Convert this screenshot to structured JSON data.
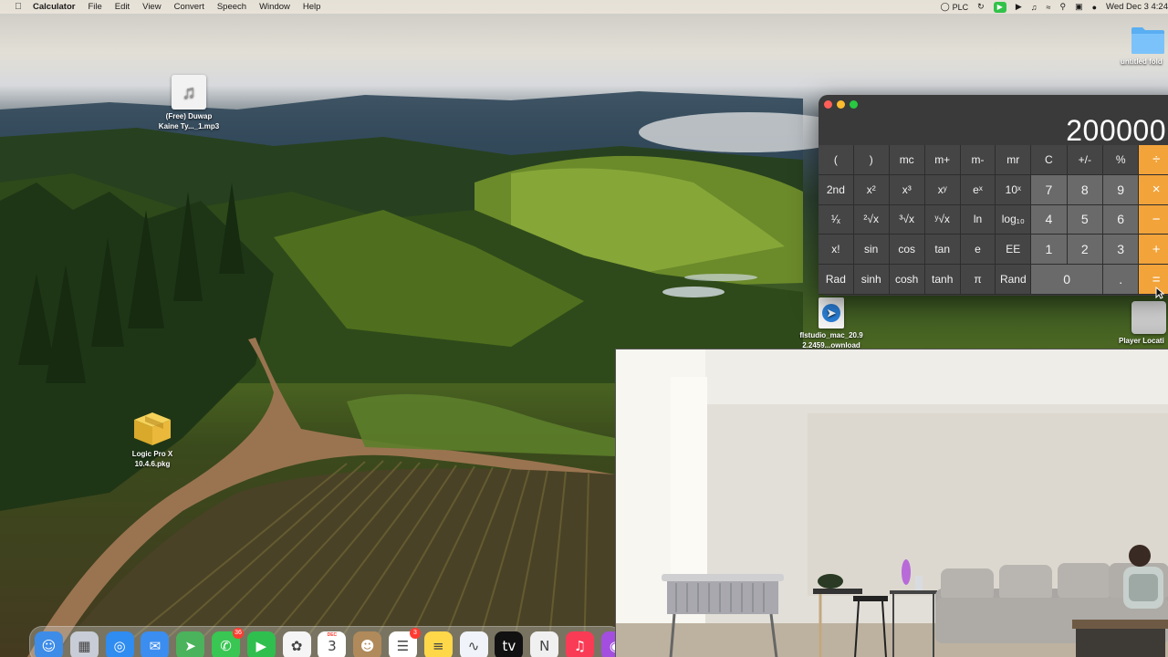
{
  "menubar": {
    "apple_icon": "apple-icon",
    "app_name": "Calculator",
    "menus": [
      "File",
      "Edit",
      "View",
      "Convert",
      "Speech",
      "Window",
      "Help"
    ],
    "status": {
      "plc_label": "PLC",
      "clock": "Wed Dec 3  4:24"
    }
  },
  "desktop": {
    "icons": [
      {
        "label_line1": "(Free) Duwap",
        "label_line2": "Kaine Ty..._1.mp3",
        "type": "music-file-icon"
      },
      {
        "label_line1": "Logic Pro X",
        "label_line2": "10.4.6.pkg",
        "type": "package-icon"
      },
      {
        "label_line1": "untitled fold",
        "label_line2": "",
        "type": "folder-icon"
      },
      {
        "label_line1": "flstudio_mac_20.9",
        "label_line2": "2.2459...ownload",
        "type": "app-file-icon"
      },
      {
        "label_line1": "Player Locati",
        "label_line2": "",
        "type": "disk-icon"
      }
    ]
  },
  "calculator": {
    "display": "200000",
    "rows": [
      [
        "(",
        ")",
        "mc",
        "m+",
        "m-",
        "mr",
        "C",
        "+/-",
        "%",
        "÷"
      ],
      [
        "2nd",
        "x²",
        "x³",
        "xʸ",
        "eˣ",
        "10ˣ",
        "7",
        "8",
        "9",
        "×"
      ],
      [
        "¹⁄ₓ",
        "²√x",
        "³√x",
        "ʸ√x",
        "ln",
        "log₁₀",
        "4",
        "5",
        "6",
        "−"
      ],
      [
        "x!",
        "sin",
        "cos",
        "tan",
        "e",
        "EE",
        "1",
        "2",
        "3",
        "+"
      ],
      [
        "Rad",
        "sinh",
        "cosh",
        "tanh",
        "π",
        "Rand",
        "0",
        ".",
        "="
      ]
    ],
    "accent_color": "#f2a33a"
  },
  "dock": {
    "apps": [
      {
        "name": "finder-icon",
        "color": "#3d8ce8",
        "glyph": "☺",
        "badge": ""
      },
      {
        "name": "launchpad-icon",
        "color": "#c8ccd6",
        "glyph": "▦",
        "badge": ""
      },
      {
        "name": "safari-icon",
        "color": "#2f8cf0",
        "glyph": "◎",
        "badge": ""
      },
      {
        "name": "mail-icon",
        "color": "#3b8df0",
        "glyph": "✉",
        "badge": ""
      },
      {
        "name": "maps-icon",
        "color": "#4bb35b",
        "glyph": "➤",
        "badge": ""
      },
      {
        "name": "messages-icon",
        "color": "#39c653",
        "glyph": "✆",
        "badge": "36"
      },
      {
        "name": "facetime-icon",
        "color": "#2fbf4f",
        "glyph": "▶",
        "badge": ""
      },
      {
        "name": "photos-icon",
        "color": "#f5f5f5",
        "glyph": "✿",
        "badge": ""
      },
      {
        "name": "calendar-icon",
        "color": "#ffffff",
        "glyph": "3",
        "badge": ""
      },
      {
        "name": "contacts-icon",
        "color": "#b08a5a",
        "glyph": "☻",
        "badge": ""
      },
      {
        "name": "reminders-icon",
        "color": "#ffffff",
        "glyph": "☰",
        "badge": "3"
      },
      {
        "name": "notes-icon",
        "color": "#ffd84a",
        "glyph": "≡",
        "badge": ""
      },
      {
        "name": "freeform-icon",
        "color": "#f0f4fa",
        "glyph": "∿",
        "badge": ""
      },
      {
        "name": "appletv-icon",
        "color": "#111111",
        "glyph": "tv",
        "badge": ""
      },
      {
        "name": "news-icon",
        "color": "#f0f0f0",
        "glyph": "N",
        "badge": ""
      },
      {
        "name": "music-icon",
        "color": "#fa3b55",
        "glyph": "♫",
        "badge": ""
      },
      {
        "name": "podcasts-icon",
        "color": "#a44ee0",
        "glyph": "◉",
        "badge": ""
      }
    ],
    "calendar_month": "DEC"
  }
}
